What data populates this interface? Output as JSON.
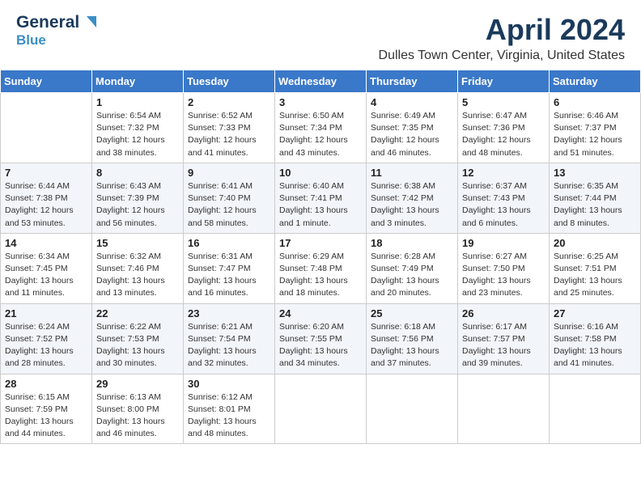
{
  "header": {
    "logo_general": "General",
    "logo_blue": "Blue",
    "title": "April 2024",
    "subtitle": "Dulles Town Center, Virginia, United States"
  },
  "days_of_week": [
    "Sunday",
    "Monday",
    "Tuesday",
    "Wednesday",
    "Thursday",
    "Friday",
    "Saturday"
  ],
  "weeks": [
    [
      {
        "day": "",
        "info": ""
      },
      {
        "day": "1",
        "info": "Sunrise: 6:54 AM\nSunset: 7:32 PM\nDaylight: 12 hours\nand 38 minutes."
      },
      {
        "day": "2",
        "info": "Sunrise: 6:52 AM\nSunset: 7:33 PM\nDaylight: 12 hours\nand 41 minutes."
      },
      {
        "day": "3",
        "info": "Sunrise: 6:50 AM\nSunset: 7:34 PM\nDaylight: 12 hours\nand 43 minutes."
      },
      {
        "day": "4",
        "info": "Sunrise: 6:49 AM\nSunset: 7:35 PM\nDaylight: 12 hours\nand 46 minutes."
      },
      {
        "day": "5",
        "info": "Sunrise: 6:47 AM\nSunset: 7:36 PM\nDaylight: 12 hours\nand 48 minutes."
      },
      {
        "day": "6",
        "info": "Sunrise: 6:46 AM\nSunset: 7:37 PM\nDaylight: 12 hours\nand 51 minutes."
      }
    ],
    [
      {
        "day": "7",
        "info": "Sunrise: 6:44 AM\nSunset: 7:38 PM\nDaylight: 12 hours\nand 53 minutes."
      },
      {
        "day": "8",
        "info": "Sunrise: 6:43 AM\nSunset: 7:39 PM\nDaylight: 12 hours\nand 56 minutes."
      },
      {
        "day": "9",
        "info": "Sunrise: 6:41 AM\nSunset: 7:40 PM\nDaylight: 12 hours\nand 58 minutes."
      },
      {
        "day": "10",
        "info": "Sunrise: 6:40 AM\nSunset: 7:41 PM\nDaylight: 13 hours\nand 1 minute."
      },
      {
        "day": "11",
        "info": "Sunrise: 6:38 AM\nSunset: 7:42 PM\nDaylight: 13 hours\nand 3 minutes."
      },
      {
        "day": "12",
        "info": "Sunrise: 6:37 AM\nSunset: 7:43 PM\nDaylight: 13 hours\nand 6 minutes."
      },
      {
        "day": "13",
        "info": "Sunrise: 6:35 AM\nSunset: 7:44 PM\nDaylight: 13 hours\nand 8 minutes."
      }
    ],
    [
      {
        "day": "14",
        "info": "Sunrise: 6:34 AM\nSunset: 7:45 PM\nDaylight: 13 hours\nand 11 minutes."
      },
      {
        "day": "15",
        "info": "Sunrise: 6:32 AM\nSunset: 7:46 PM\nDaylight: 13 hours\nand 13 minutes."
      },
      {
        "day": "16",
        "info": "Sunrise: 6:31 AM\nSunset: 7:47 PM\nDaylight: 13 hours\nand 16 minutes."
      },
      {
        "day": "17",
        "info": "Sunrise: 6:29 AM\nSunset: 7:48 PM\nDaylight: 13 hours\nand 18 minutes."
      },
      {
        "day": "18",
        "info": "Sunrise: 6:28 AM\nSunset: 7:49 PM\nDaylight: 13 hours\nand 20 minutes."
      },
      {
        "day": "19",
        "info": "Sunrise: 6:27 AM\nSunset: 7:50 PM\nDaylight: 13 hours\nand 23 minutes."
      },
      {
        "day": "20",
        "info": "Sunrise: 6:25 AM\nSunset: 7:51 PM\nDaylight: 13 hours\nand 25 minutes."
      }
    ],
    [
      {
        "day": "21",
        "info": "Sunrise: 6:24 AM\nSunset: 7:52 PM\nDaylight: 13 hours\nand 28 minutes."
      },
      {
        "day": "22",
        "info": "Sunrise: 6:22 AM\nSunset: 7:53 PM\nDaylight: 13 hours\nand 30 minutes."
      },
      {
        "day": "23",
        "info": "Sunrise: 6:21 AM\nSunset: 7:54 PM\nDaylight: 13 hours\nand 32 minutes."
      },
      {
        "day": "24",
        "info": "Sunrise: 6:20 AM\nSunset: 7:55 PM\nDaylight: 13 hours\nand 34 minutes."
      },
      {
        "day": "25",
        "info": "Sunrise: 6:18 AM\nSunset: 7:56 PM\nDaylight: 13 hours\nand 37 minutes."
      },
      {
        "day": "26",
        "info": "Sunrise: 6:17 AM\nSunset: 7:57 PM\nDaylight: 13 hours\nand 39 minutes."
      },
      {
        "day": "27",
        "info": "Sunrise: 6:16 AM\nSunset: 7:58 PM\nDaylight: 13 hours\nand 41 minutes."
      }
    ],
    [
      {
        "day": "28",
        "info": "Sunrise: 6:15 AM\nSunset: 7:59 PM\nDaylight: 13 hours\nand 44 minutes."
      },
      {
        "day": "29",
        "info": "Sunrise: 6:13 AM\nSunset: 8:00 PM\nDaylight: 13 hours\nand 46 minutes."
      },
      {
        "day": "30",
        "info": "Sunrise: 6:12 AM\nSunset: 8:01 PM\nDaylight: 13 hours\nand 48 minutes."
      },
      {
        "day": "",
        "info": ""
      },
      {
        "day": "",
        "info": ""
      },
      {
        "day": "",
        "info": ""
      },
      {
        "day": "",
        "info": ""
      }
    ]
  ]
}
